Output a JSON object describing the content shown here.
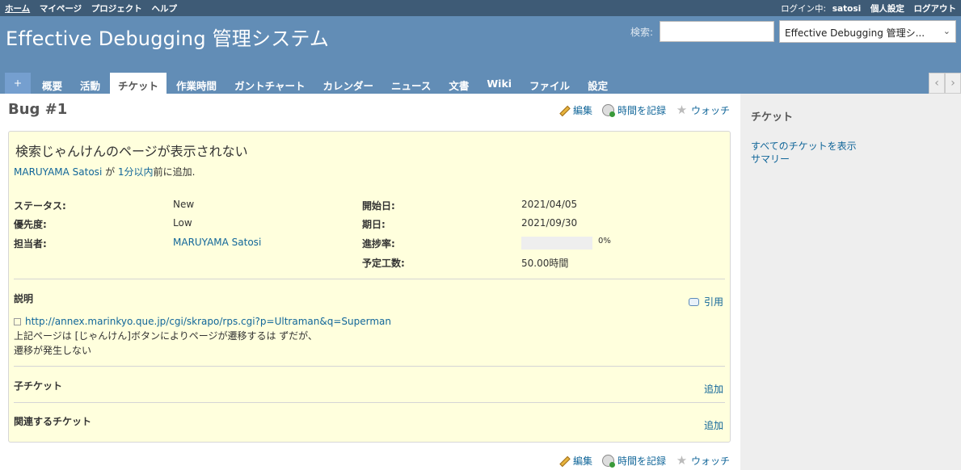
{
  "top_menu": {
    "left": [
      "ホーム",
      "マイページ",
      "プロジェクト",
      "ヘルプ"
    ],
    "login_label": "ログイン中:",
    "login_user": "satosi",
    "right": [
      "個人設定",
      "ログアウト"
    ]
  },
  "header": {
    "title": "Effective Debugging 管理システム",
    "search_label": "検索:",
    "search_value": "",
    "project_select": "Effective Debugging 管理シ...",
    "select_arrow": "⌄"
  },
  "main_menu": {
    "plus": "+",
    "tabs": [
      "概要",
      "活動",
      "チケット",
      "作業時間",
      "ガントチャート",
      "カレンダー",
      "ニュース",
      "文書",
      "Wiki",
      "ファイル",
      "設定"
    ],
    "selected": "チケット",
    "arrow_left": "‹",
    "arrow_right": "›"
  },
  "issue": {
    "title": "Bug #1",
    "actions": [
      "編集",
      "時間を記録",
      "ウォッチ"
    ],
    "subject": "検索じゃんけんのページが表示されない",
    "author": "MARUYAMA Satosi",
    "author_sep": " が ",
    "time_ago": "1分以内",
    "added_text": "前に追加.",
    "attributes_left": [
      {
        "label": "ステータス:",
        "value": "New"
      },
      {
        "label": "優先度:",
        "value": "Low"
      },
      {
        "label": "担当者:",
        "value": "MARUYAMA Satosi"
      }
    ],
    "attributes_right": [
      {
        "label": "開始日:",
        "value": "2021/04/05"
      },
      {
        "label": "期日:",
        "value": "2021/09/30"
      },
      {
        "label": "進捗率:",
        "value": "0%"
      },
      {
        "label": "予定工数:",
        "value": "50.00時間"
      }
    ],
    "progress": 0,
    "description_heading": "説明",
    "quote_label": "引用",
    "description_link": "http://annex.marinkyo.que.jp/cgi/skrapo/rps.cgi?p=Ultraman&q=Superman",
    "description_lines": [
      "上記ページは [じゃんけん]ボタンによりページが遷移するは ずだが、",
      "遷移が発生しない"
    ],
    "subtasks_heading": "子チケット",
    "subtasks_add": "追加",
    "relations_heading": "関連するチケット",
    "relations_add": "追加"
  },
  "sidebar": {
    "heading": "チケット",
    "links": [
      "すべてのチケットを表示",
      "サマリー"
    ]
  },
  "colors": {
    "top_bar": "#3e5b76",
    "header": "#628db6",
    "issue_bg": "#ffffdd",
    "link": "#169",
    "sidebar_bg": "#eeeeee"
  },
  "icons": [
    "pencil-icon",
    "clock-icon",
    "star-icon",
    "speech-bubble-icon",
    "external-link-icon"
  ]
}
